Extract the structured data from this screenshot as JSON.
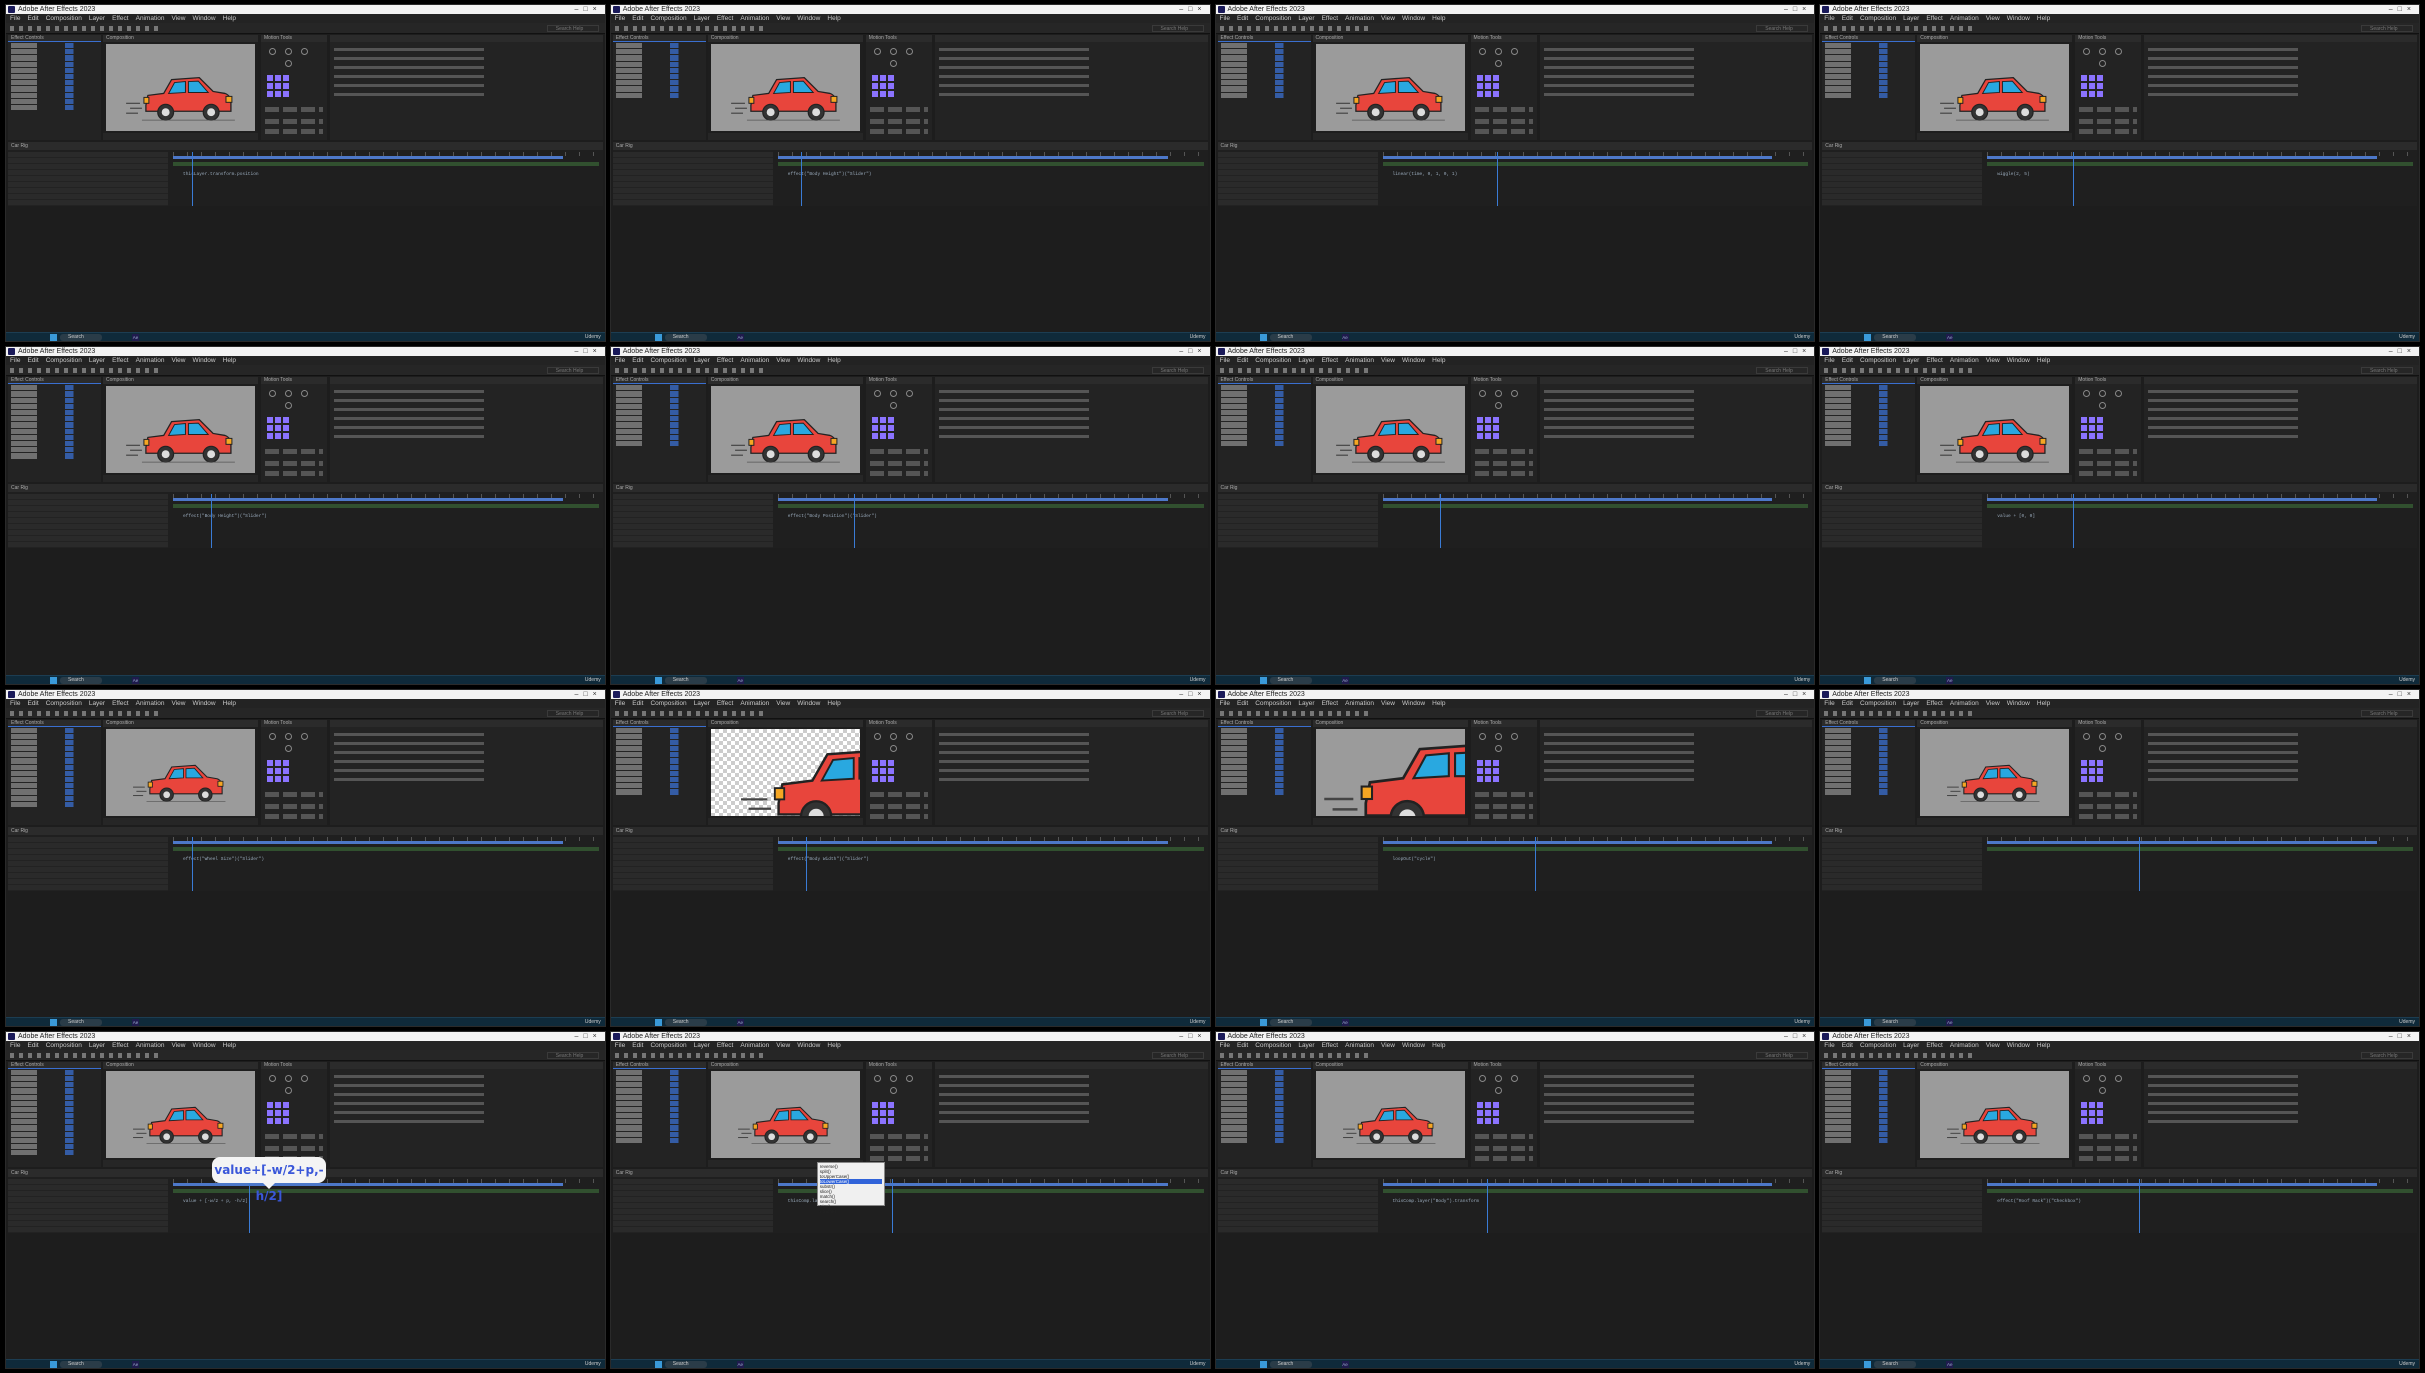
{
  "app": {
    "window_title": "Adobe After Effects 2023",
    "menus": [
      "File",
      "Edit",
      "Composition",
      "Layer",
      "Effect",
      "Animation",
      "View",
      "Window",
      "Help"
    ],
    "search_help": "Search Help",
    "panels": {
      "effect_controls": "Effect Controls",
      "composition": "Composition",
      "motion_tools": "Motion Tools",
      "timeline": "Car Rig"
    },
    "taskbar_search": "Search",
    "taskbar_app": "Ae",
    "clock": "Udemy"
  },
  "cells": [
    {
      "stage": "grey",
      "car": "normal",
      "expr": "thisLayer.transform.position"
    },
    {
      "stage": "grey",
      "car": "normal",
      "expr": "effect(\"Body Height\")(\"Slider\")"
    },
    {
      "stage": "grey",
      "car": "normal",
      "expr": "linear(time, 0, 1, 0, 1)"
    },
    {
      "stage": "grey",
      "car": "normal",
      "expr": "wiggle(2, 5)"
    },
    {
      "stage": "grey",
      "car": "normal",
      "expr": "effect(\"Body Height\")(\"Slider\")"
    },
    {
      "stage": "grey",
      "car": "normal",
      "expr": "effect(\"Body Position\")(\"Slider\")"
    },
    {
      "stage": "grey",
      "car": "normal",
      "expr": ""
    },
    {
      "stage": "grey",
      "car": "normal",
      "expr": "value + [0, 0]"
    },
    {
      "stage": "grey",
      "car": "small",
      "expr": "effect(\"Wheel Size\")(\"Slider\")"
    },
    {
      "stage": "checker",
      "car": "large",
      "expr": "effect(\"Body Width\")(\"Slider\")"
    },
    {
      "stage": "grey",
      "car": "zoom",
      "expr": "loopOut(\"cycle\")"
    },
    {
      "stage": "grey",
      "car": "small",
      "expr": ""
    },
    {
      "stage": "grey",
      "car": "small",
      "expr": "value + [-w/2 + p, -h/2]"
    },
    {
      "stage": "grey",
      "car": "small",
      "expr": "thisComp.layer(\"Car\")"
    },
    {
      "stage": "grey",
      "car": "small",
      "expr": "thisComp.layer(\"Body\").transform"
    },
    {
      "stage": "grey",
      "car": "small",
      "expr": "effect(\"Roof Rack\")(\"Checkbox\")"
    }
  ],
  "callout": {
    "cell": 12,
    "text": "value+[-w/2+p,-h/2]"
  },
  "popup": {
    "cell": 13,
    "items": [
      "reverse()",
      "split()",
      "toUpperCase()",
      "toLowerCase()",
      "substr()",
      "slice()",
      "match()",
      "search()",
      "trim()",
      "concat()"
    ],
    "selected": 3
  },
  "colors": {
    "car_body": "#e8453c",
    "car_window": "#29a8e0",
    "wheel_rim": "#f5a623",
    "outline": "#222222",
    "stage_grey": "#9b9b9b",
    "accent": "#3a7bd5",
    "motion_tools_pads": "#8b73ff"
  }
}
